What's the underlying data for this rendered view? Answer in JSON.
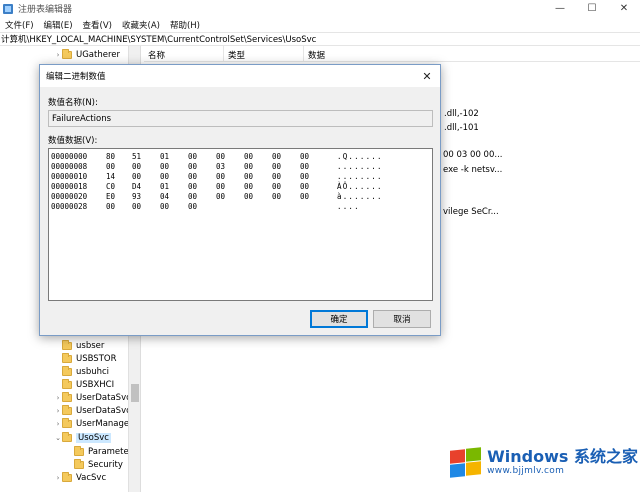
{
  "window": {
    "title": "注册表编辑器",
    "controls": {
      "minimize": "—",
      "maximize": "☐",
      "close": "✕"
    }
  },
  "menu": [
    "文件(F)",
    "编辑(E)",
    "查看(V)",
    "收藏夹(A)",
    "帮助(H)"
  ],
  "address": "计算机\\HKEY_LOCAL_MACHINE\\SYSTEM\\CurrentControlSet\\Services\\UsoSvc",
  "tree": {
    "top_items": [
      {
        "label": "UGatherer",
        "chevron": "›"
      }
    ],
    "bottom_items": [
      {
        "label": "usbser",
        "chevron": ""
      },
      {
        "label": "USBSTOR",
        "chevron": ""
      },
      {
        "label": "usbuhci",
        "chevron": ""
      },
      {
        "label": "USBXHCI",
        "chevron": ""
      },
      {
        "label": "UserDataSvc",
        "chevron": "›"
      },
      {
        "label": "UserDataSvc",
        "chevron": "›"
      },
      {
        "label": "UserManage",
        "chevron": "›"
      },
      {
        "label": "UsoSvc",
        "chevron": "⌄"
      },
      {
        "label": "Parameter",
        "chevron": ""
      },
      {
        "label": "Security",
        "chevron": ""
      },
      {
        "label": "VacSvc",
        "chevron": "›"
      }
    ]
  },
  "list": {
    "columns": [
      "名称",
      "类型",
      "数据"
    ],
    "peek_rows": [
      ".dll,-102",
      ".dll,-101",
      "00 03 00 00...",
      "exe -k netsv...",
      "vilege SeCr..."
    ]
  },
  "dialog": {
    "title": "编辑二进制数值",
    "close": "✕",
    "value_name_label": "数值名称(N):",
    "value_name": "FailureActions",
    "value_data_label": "数值数据(V):",
    "hex_rows": [
      {
        "offset": "00000000",
        "bytes": [
          "80",
          "51",
          "01",
          "00",
          "00",
          "00",
          "00",
          "00"
        ],
        "ascii": ".Q......"
      },
      {
        "offset": "00000008",
        "bytes": [
          "00",
          "00",
          "00",
          "00",
          "03",
          "00",
          "00",
          "00"
        ],
        "ascii": "........"
      },
      {
        "offset": "00000010",
        "bytes": [
          "14",
          "00",
          "00",
          "00",
          "00",
          "00",
          "00",
          "00"
        ],
        "ascii": "........"
      },
      {
        "offset": "00000018",
        "bytes": [
          "C0",
          "D4",
          "01",
          "00",
          "00",
          "00",
          "00",
          "00"
        ],
        "ascii": "ÀÔ......"
      },
      {
        "offset": "00000020",
        "bytes": [
          "E0",
          "93",
          "04",
          "00",
          "00",
          "00",
          "00",
          "00"
        ],
        "ascii": "à......."
      },
      {
        "offset": "00000028",
        "bytes": [
          "00",
          "00",
          "00",
          "00",
          "",
          "",
          "",
          ""
        ],
        "ascii": "...."
      }
    ],
    "ok_label": "确定",
    "cancel_label": "取消"
  },
  "watermark": {
    "title": "Windows 系统之家",
    "url": "www.bjjmlv.com",
    "colors": [
      "#e8412c",
      "#7ab800",
      "#1e88e5",
      "#f5b400"
    ]
  }
}
